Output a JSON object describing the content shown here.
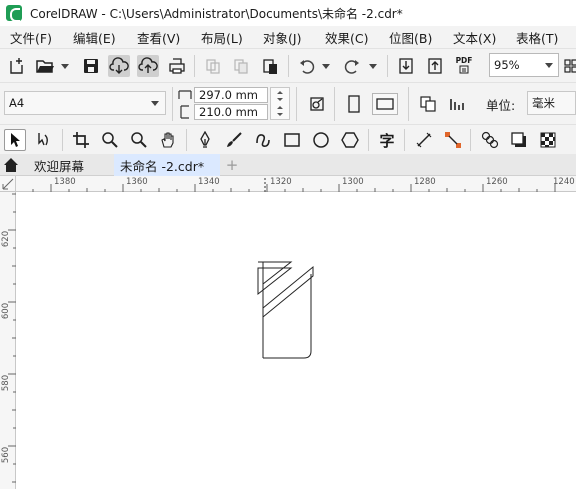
{
  "window": {
    "title": "CorelDRAW - C:\\Users\\Administrator\\Documents\\未命名 -2.cdr*"
  },
  "menu": [
    {
      "label": "文件(F)"
    },
    {
      "label": "编辑(E)"
    },
    {
      "label": "查看(V)"
    },
    {
      "label": "布局(L)"
    },
    {
      "label": "对象(J)"
    },
    {
      "label": "效果(C)"
    },
    {
      "label": "位图(B)"
    },
    {
      "label": "文本(X)"
    },
    {
      "label": "表格(T)"
    }
  ],
  "standard_toolbar": {
    "pdf_label": "PDF",
    "zoom_value": "95%"
  },
  "property_bar": {
    "page_size": "A4",
    "width": "297.0 mm",
    "height": "210.0 mm",
    "units_label": "单位:",
    "units_value": "毫米"
  },
  "toolbox": {
    "text_tool_glyph": "字"
  },
  "tabs": [
    {
      "label": "欢迎屏幕"
    },
    {
      "label": "未命名 -2.cdr*"
    }
  ],
  "add_tab_glyph": "+",
  "ruler": {
    "horizontal": [
      "1380",
      "1360",
      "1340",
      "1320",
      "1300",
      "1280",
      "1260",
      "1240"
    ],
    "vertical": [
      "620",
      "600",
      "580",
      "560"
    ]
  },
  "colors": {
    "accent": "#1f9d55",
    "active_tab": "#dbe9ff",
    "canvas": "#ffffff"
  }
}
